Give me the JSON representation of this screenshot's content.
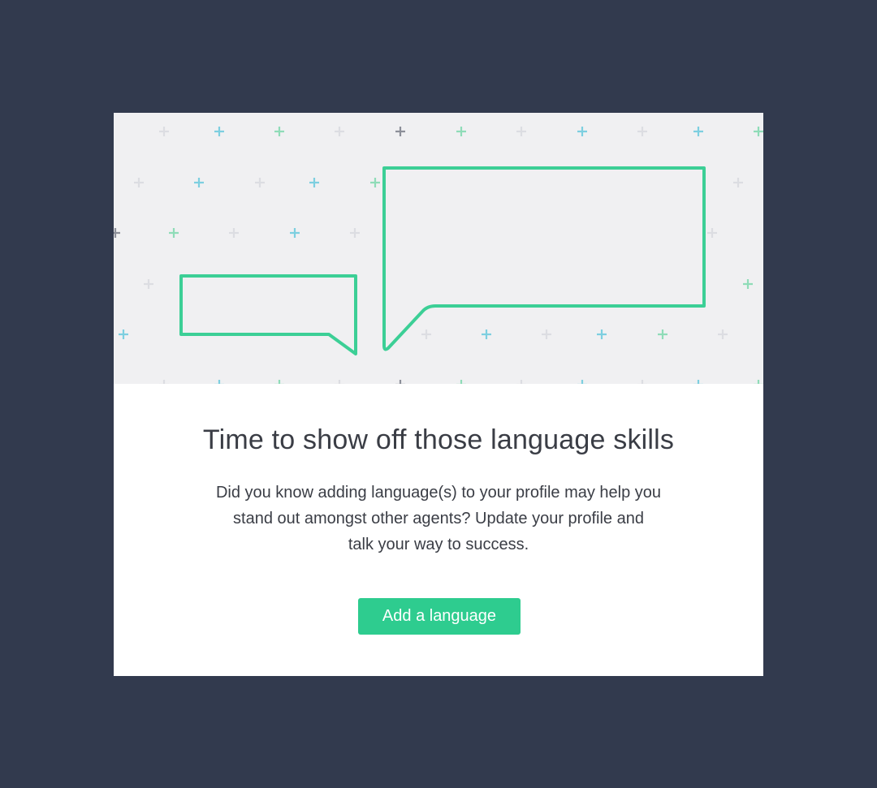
{
  "modal": {
    "title": "Time to show off those language skills",
    "body_lines": [
      "Did you know adding language(s) to your profile may help you",
      "stand out amongst other agents? Update your profile and",
      "talk your way to success."
    ],
    "cta_label": "Add a language"
  },
  "hero": {
    "illustration": "two-speech-bubbles-with-plus-pattern",
    "bubble_stroke_color": "#3ccf96",
    "plus_colors": [
      "#7dcfe0",
      "#8fdcb8",
      "#dcdde2",
      "#8c8f99"
    ]
  },
  "colors": {
    "backdrop": "#323a4e",
    "card": "#ffffff",
    "hero_bg": "#f0f0f2",
    "accent": "#2ecc8f",
    "text": "#3a3d45"
  }
}
